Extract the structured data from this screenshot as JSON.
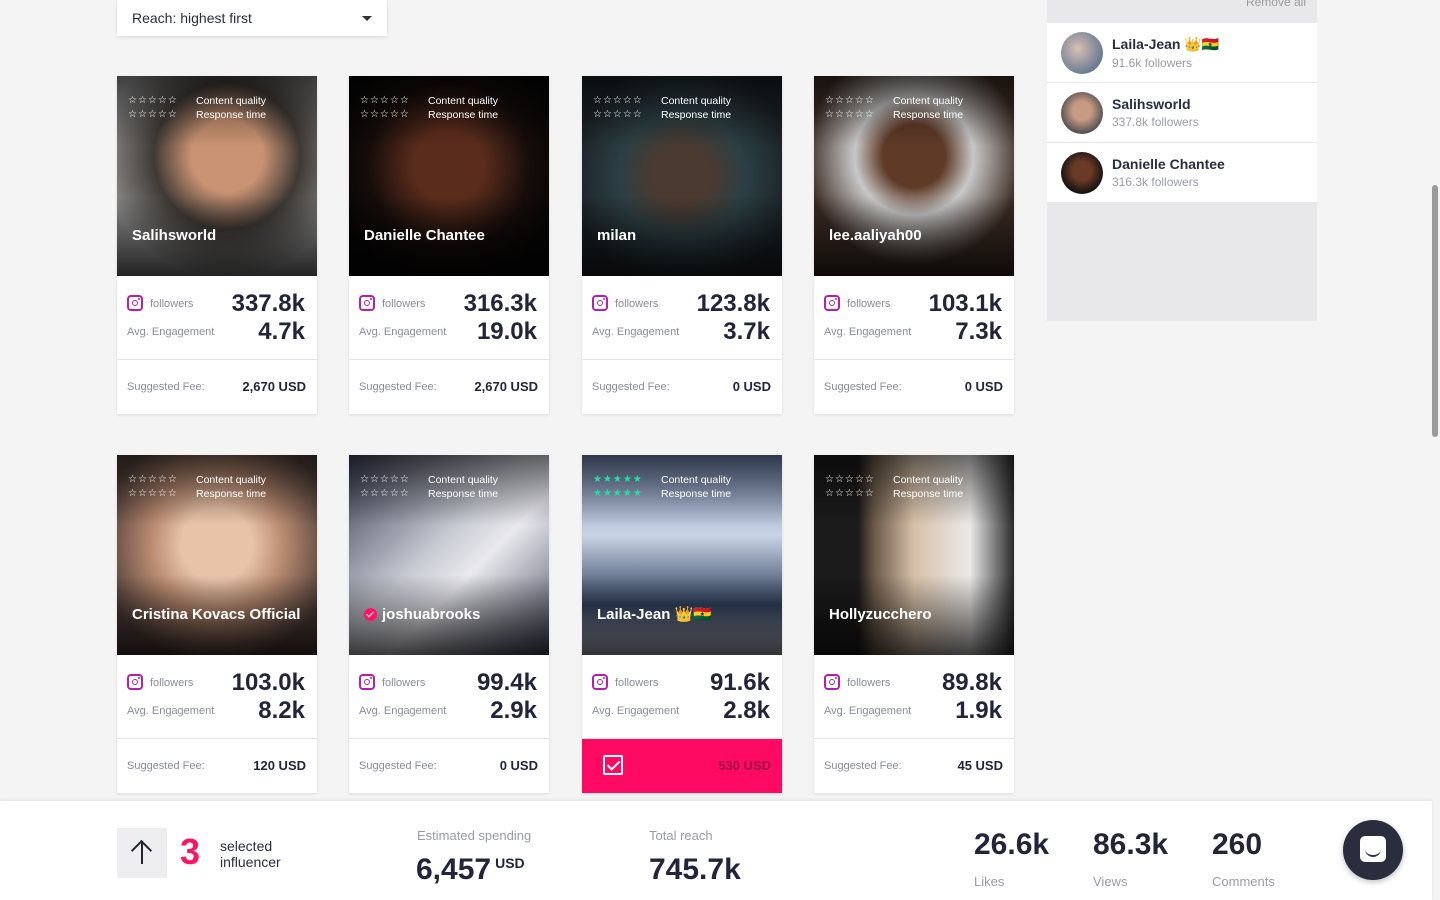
{
  "sort": {
    "label": "Reach: highest first"
  },
  "rating_labels": {
    "quality": "Content quality",
    "response": "Response time"
  },
  "stat_labels": {
    "followers": "followers",
    "engagement": "Avg. Engagement",
    "fee": "Suggested Fee:"
  },
  "cards": [
    {
      "name": "Salihsworld",
      "followers": "337.8k",
      "engagement": "4.7k",
      "fee": "2,670 USD",
      "stars_quality": "☆☆☆☆☆",
      "stars_response": "☆☆☆☆☆",
      "selected": false
    },
    {
      "name": "Danielle Chantee",
      "followers": "316.3k",
      "engagement": "19.0k",
      "fee": "2,670 USD",
      "stars_quality": "☆☆☆☆☆",
      "stars_response": "☆☆☆☆☆",
      "selected": false
    },
    {
      "name": "milan",
      "followers": "123.8k",
      "engagement": "3.7k",
      "fee": "0 USD",
      "stars_quality": "☆☆☆☆☆",
      "stars_response": "☆☆☆☆☆",
      "selected": false
    },
    {
      "name": "lee.aaliyah00",
      "followers": "103.1k",
      "engagement": "7.3k",
      "fee": "0 USD",
      "stars_quality": "☆☆☆☆☆",
      "stars_response": "☆☆☆☆☆",
      "selected": false
    },
    {
      "name": "Cristina Kovacs Official",
      "followers": "103.0k",
      "engagement": "8.2k",
      "fee": "120 USD",
      "stars_quality": "☆☆☆☆☆",
      "stars_response": "☆☆☆☆☆",
      "selected": false
    },
    {
      "name": "joshuabrooks",
      "followers": "99.4k",
      "engagement": "2.9k",
      "fee": "0 USD",
      "stars_quality": "☆☆☆☆☆",
      "stars_response": "☆☆☆☆☆",
      "selected": false,
      "verified": true
    },
    {
      "name": "Laila-Jean 👑🇬🇭",
      "followers": "91.6k",
      "engagement": "2.8k",
      "fee": "530 USD",
      "stars_quality": "★★★★★",
      "stars_response": "★★★★★",
      "selected": true
    },
    {
      "name": "Hollyzucchero",
      "followers": "89.8k",
      "engagement": "1.9k",
      "fee": "45 USD",
      "stars_quality": "☆☆☆☆☆",
      "stars_response": "☆☆☆☆☆",
      "selected": false
    }
  ],
  "panel": {
    "remove_all": "Remove all",
    "items": [
      {
        "name": "Laila-Jean 👑🇬🇭",
        "sub": "91.6k followers"
      },
      {
        "name": "Salihsworld",
        "sub": "337.8k followers"
      },
      {
        "name": "Danielle Chantee",
        "sub": "316.3k followers"
      }
    ]
  },
  "bottom": {
    "count": "3",
    "count_label": "selected influencer",
    "spending_label": "Estimated spending",
    "spending_value": "6,457",
    "spending_unit": "USD",
    "reach_label": "Total reach",
    "reach_value": "745.7k",
    "likes_value": "26.6k",
    "likes_label": "Likes",
    "views_value": "86.3k",
    "views_label": "Views",
    "comments_value": "260",
    "comments_label": "Comments"
  },
  "colors": {
    "accent": "#ff1464",
    "star_on": "#1ee0a8",
    "instagram": "#b41fae",
    "dark": "#22253a"
  }
}
